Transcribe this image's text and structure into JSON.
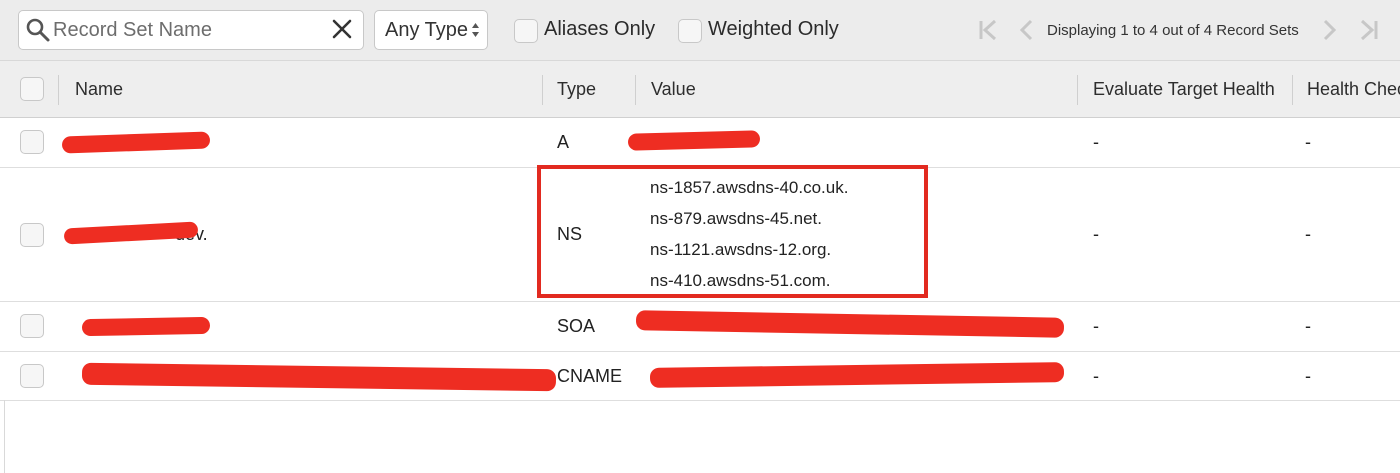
{
  "toolbar": {
    "search_placeholder": "Record Set Name",
    "type_filter": "Any Type",
    "aliases_only_label": "Aliases Only",
    "weighted_only_label": "Weighted Only",
    "pagination_text": "Displaying 1 to 4 out of 4 Record Sets"
  },
  "columns": {
    "name": "Name",
    "type": "Type",
    "value": "Value",
    "evaluate_target_health": "Evaluate Target Health",
    "health_check": "Health Chec"
  },
  "rows": [
    {
      "name": "",
      "type": "A",
      "values": [],
      "evaluate_target_health": "-",
      "health_check": "-"
    },
    {
      "name": "dev.",
      "type": "NS",
      "values": [
        "ns-1857.awsdns-40.co.uk.",
        "ns-879.awsdns-45.net.",
        "ns-1121.awsdns-12.org.",
        "ns-410.awsdns-51.com."
      ],
      "evaluate_target_health": "-",
      "health_check": "-"
    },
    {
      "name": "",
      "type": "SOA",
      "values": [],
      "evaluate_target_health": "-",
      "health_check": "-"
    },
    {
      "name": "",
      "type": "CNAME",
      "values": [],
      "evaluate_target_health": "-",
      "health_check": "-"
    }
  ],
  "colors": {
    "redaction": "#ee2d22",
    "highlight_border": "#e22a20",
    "toolbar_bg": "#ececec"
  },
  "icons": {
    "search": "magnifier-icon",
    "clear": "close-icon",
    "select": "updown-arrows-icon",
    "first": "first-page-icon",
    "prev": "prev-page-icon",
    "next": "next-page-icon",
    "last": "last-page-icon"
  }
}
